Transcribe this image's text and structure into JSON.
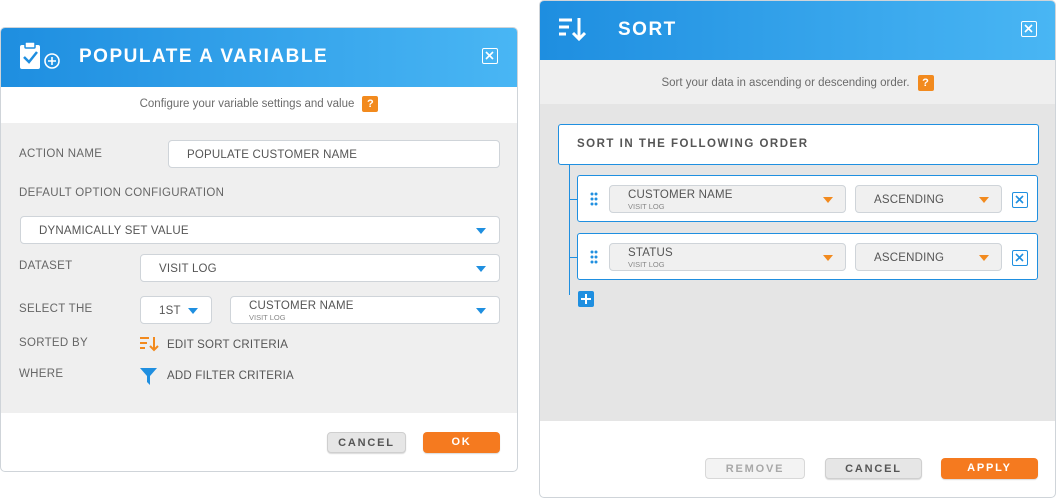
{
  "populate": {
    "title": "POPULATE A VARIABLE",
    "subtitle": "Configure your variable settings and value",
    "help": "?",
    "action_name_label": "ACTION NAME",
    "action_name_value": "POPULATE CUSTOMER NAME",
    "default_option_label": "DEFAULT OPTION CONFIGURATION",
    "default_option_value": "DYNAMICALLY SET VALUE",
    "dataset_label": "DATASET",
    "dataset_value": "VISIT LOG",
    "select_the_label": "SELECT THE",
    "select_the_value": "1ST",
    "select_field_value": "CUSTOMER NAME",
    "select_field_sub": "VISIT LOG",
    "sorted_by_label": "SORTED BY",
    "sorted_by_link": "EDIT SORT CRITERIA",
    "where_label": "WHERE",
    "where_link": "ADD FILTER CRITERIA",
    "cancel": "CANCEL",
    "ok": "OK"
  },
  "sort": {
    "title": "SORT",
    "subtitle": "Sort your data in ascending or descending order.",
    "help": "?",
    "order_header": "SORT IN THE FOLLOWING ORDER",
    "rows": [
      {
        "field": "CUSTOMER NAME",
        "sub": "VISIT LOG",
        "direction": "ASCENDING"
      },
      {
        "field": "STATUS",
        "sub": "VISIT LOG",
        "direction": "ASCENDING"
      }
    ],
    "remove": "REMOVE",
    "cancel": "CANCEL",
    "apply": "APPLY"
  },
  "colors": {
    "header_blue": "#1e8ee0",
    "accent_orange": "#f57a1f",
    "link_blue": "#1f8fe0"
  }
}
